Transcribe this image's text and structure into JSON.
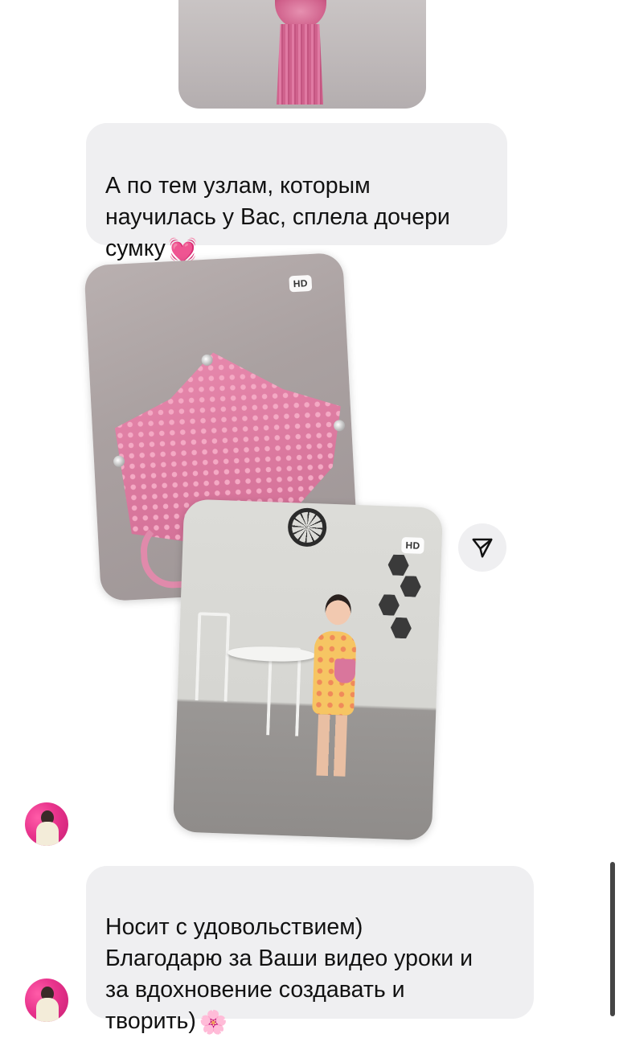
{
  "messages": [
    {
      "type": "image",
      "description_icon": "tassel-photo"
    },
    {
      "type": "text",
      "text": "А по тем узлам, которым\nнаучилась у Вас, сплела дочери\nсумку",
      "emoji": "💓"
    },
    {
      "type": "image",
      "badge": "HD"
    },
    {
      "type": "image",
      "badge": "HD"
    },
    {
      "type": "text",
      "text": "Носит с удовольствием)\nБлагодарю за Ваши видео уроки и\nза вдохновение создавать и\nтворить)",
      "emoji": "🌸"
    }
  ],
  "share_button": {
    "icon": "paper-plane-icon"
  },
  "colors": {
    "bubble_background": "#efeff1",
    "avatar_accent": "#e8338c",
    "scrollbar": "#454545"
  }
}
